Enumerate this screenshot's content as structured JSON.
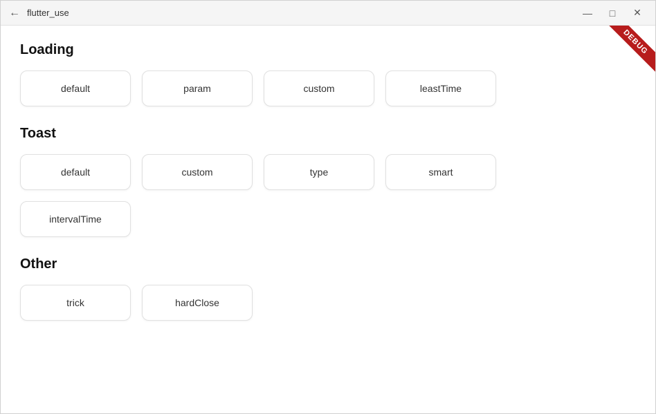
{
  "window": {
    "title": "flutter_use",
    "back_label": "←",
    "minimize_label": "—",
    "maximize_label": "□",
    "close_label": "✕",
    "debug_label": "DEBUG"
  },
  "sections": [
    {
      "id": "loading",
      "title": "Loading",
      "rows": [
        [
          "default",
          "param",
          "custom",
          "leastTime"
        ]
      ]
    },
    {
      "id": "toast",
      "title": "Toast",
      "rows": [
        [
          "default",
          "custom",
          "type",
          "smart"
        ],
        [
          "intervalTime"
        ]
      ]
    },
    {
      "id": "other",
      "title": "Other",
      "rows": [
        [
          "trick",
          "hardClose"
        ]
      ]
    }
  ]
}
